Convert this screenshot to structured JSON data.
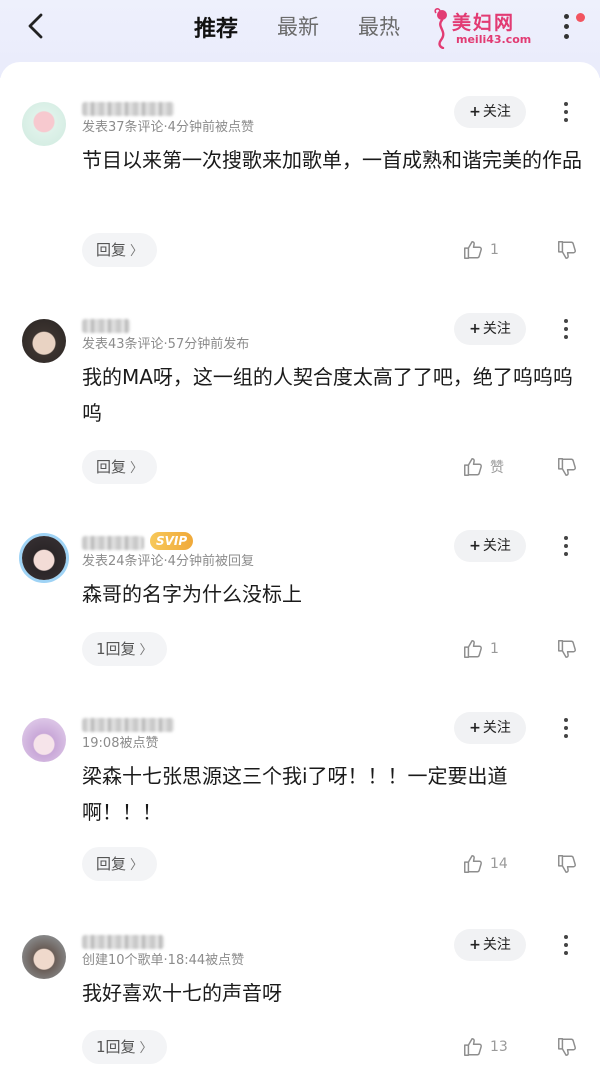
{
  "header": {
    "tabs": [
      {
        "label": "推荐",
        "active": true
      },
      {
        "label": "最新",
        "active": false
      },
      {
        "label": "最热",
        "active": false
      }
    ],
    "brand_name": "美妇网",
    "brand_domain": "meili43.com",
    "icons": {
      "back": "chevron-left-icon",
      "more": "more-vertical-icon",
      "notification": "red-dot-badge"
    }
  },
  "follow_label": "关注",
  "comments": [
    {
      "meta": "发表37条评论·4分钟前被点赞",
      "text": "节目以来第一次搜歌来加歌单，一首成熟和谐完美的作品",
      "reply_label": "回复",
      "like_label": "1",
      "svip": null
    },
    {
      "meta": "发表43条评论·57分钟前发布",
      "text": "我的MA呀，这一组的人契合度太高了了吧，绝了呜呜呜呜",
      "reply_label": "回复",
      "like_label": "赞",
      "svip": null
    },
    {
      "meta": "发表24条评论·4分钟前被回复",
      "text": "森哥的名字为什么没标上",
      "reply_label": "1回复",
      "like_label": "1",
      "svip": "SVIP"
    },
    {
      "meta": "19:08被点赞",
      "text": "梁森十七张思源这三个我i了呀！！！一定要出道啊！！！",
      "reply_label": "回复",
      "like_label": "14",
      "svip": null
    },
    {
      "meta": "创建10个歌单·18:44被点赞",
      "text": "我好喜欢十七的声音呀",
      "reply_label": "1回复",
      "like_label": "13",
      "svip": null
    }
  ],
  "colors": {
    "header_bg": "#eceefb",
    "brand": "#e23b73",
    "svip": "#f0a93a",
    "follow_bg": "#f1f2f4",
    "meta_text": "#8c8c8c"
  }
}
